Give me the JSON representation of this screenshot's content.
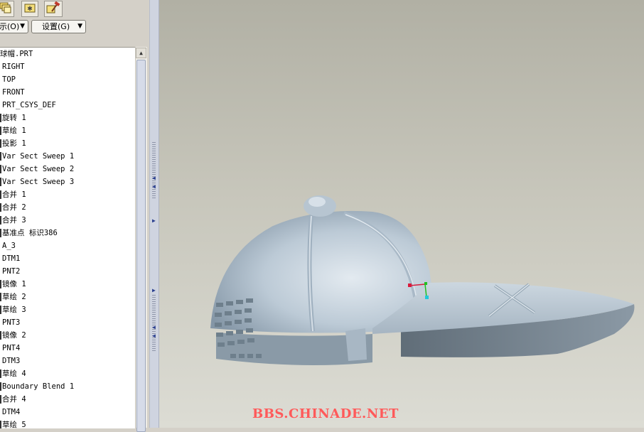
{
  "toolbar": {
    "icons": [
      "layers-icon",
      "star-folder-icon",
      "hammer-icon"
    ]
  },
  "controls": {
    "show_menu_label": "示(O)",
    "settings_menu_label": "设置(G)"
  },
  "tree": {
    "root_label": "球帽.PRT",
    "items": [
      "RIGHT",
      "TOP",
      "FRONT",
      "PRT_CSYS_DEF",
      "旋转 1",
      "草绘 1",
      "投影 1",
      "Var Sect Sweep 1",
      "Var Sect Sweep 2",
      "Var Sect Sweep 3",
      "合并 1",
      "合并 2",
      "合并 3",
      "基准点 标识386",
      "A_3",
      "DTM1",
      "PNT2",
      "镜像 1",
      "草绘 2",
      "草绘 3",
      "PNT3",
      "镜像 2",
      "PNT4",
      "DTM3",
      "草绘 4",
      "Boundary Blend 1",
      "合并 4",
      "DTM4",
      "草绘 5"
    ],
    "marked_rows": [
      4,
      5,
      6,
      7,
      8,
      9,
      10,
      11,
      12,
      13,
      17,
      18,
      19,
      21,
      24,
      25,
      26,
      28
    ]
  },
  "viewport": {
    "model_name": "baseball-cap"
  },
  "watermark": "BBS.CHINADE.NET",
  "colors": {
    "panel_bg": "#d4d0c8",
    "tree_bg": "#ffffff",
    "viewport_top": "#b1b0a4",
    "viewport_bottom": "#dcdcd4",
    "model_fill": "#b8c6d3",
    "watermark": "#ff5a5a"
  }
}
